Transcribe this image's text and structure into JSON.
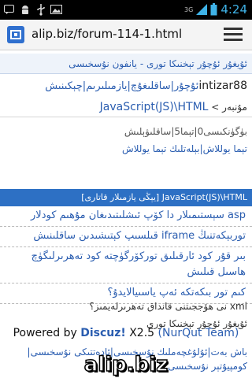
{
  "status_bar": {
    "network": "3G",
    "time": "4:24",
    "icons": [
      "sms-icon",
      "android-icon",
      "usb-icon",
      "image-icon",
      "signal-icon",
      "battery-icon"
    ]
  },
  "browser": {
    "url": "alip.biz/forum-114-1.html"
  },
  "page": {
    "breadcrumb": "ئۇيغۇر ئۇچۇر تېخنىكا تورى - يانفون نۇسخىسى",
    "user": {
      "name": "intizar88",
      "links": "ئۇچۇر|ساقلىغۇچ|يازمىلىرىم|چېكىنىش"
    },
    "location": {
      "label": "مۇنبەر",
      "separator": ">",
      "current": "JavaScript(JS)\\HTML"
    },
    "stats": {
      "line1": "بۈگۈنكىسى0|تېما5|ساقلىۋېلىش",
      "line2": "تېما يوللاش|بېلەتلىك تېما يوللاش"
    },
    "forum_header": "JavaScript(JS)\\HTML [يېڭى يازمىلار قاتارى]",
    "threads": [
      "asp سېستىمىلار دا كۆپ ئىشلىتىدىغان مۇھىم كودلار",
      "توربېكەتنىڭ iframe قىلسىپ كېتىشىدىن ساقلىنىش",
      "بىر قۇر كود ئارقىلىق توركۆرگۈچتە كود تەھرىرلىگۈچ ھاسىل قىلىش",
      "كىم تور بىكەتكە ئەپ ياسىيالايدۇ؟",
      "xml نى ھۆججىتنى قانداق تەھرىرلەيمىز؟"
    ],
    "footer": {
      "site_name": "ئۇيغۇر ئۇچۇر تېخنىكا تورى",
      "powered_prefix": "Powered by",
      "powered_brand": "Discuz!",
      "powered_version": "X2.5",
      "powered_team": "(NurQut Team)",
      "links": "باش بەت|ئۇلۇغچەملىك نۇسخىسى|ئادەتتىكى نۇسخىسى|كومپيۇتېر نۇسخىسى"
    },
    "watermark": "alip.biz"
  },
  "colors": {
    "link": "#2a5db0",
    "forum_bar": "#2d70c4",
    "clock": "#3fb3e8"
  }
}
